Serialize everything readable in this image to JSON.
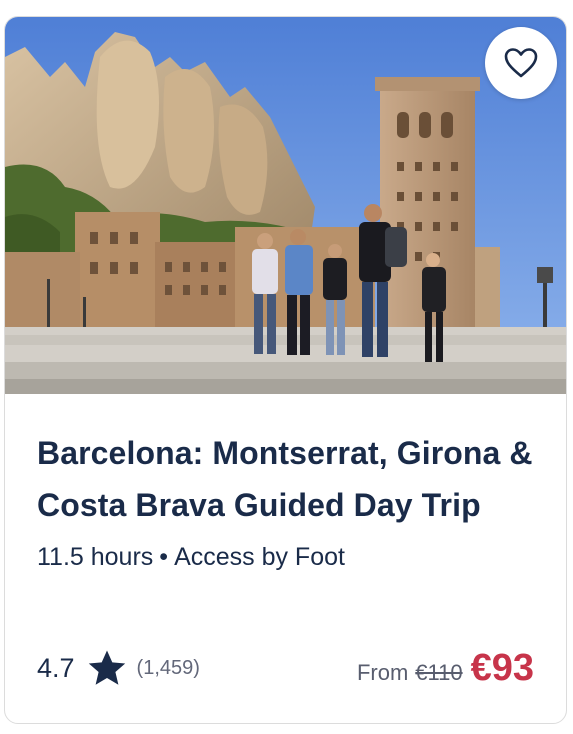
{
  "card": {
    "title": "Barcelona: Montserrat, Girona & Costa Brava Guided Day Trip",
    "duration": "11.5 hours",
    "separator": "•",
    "access": "Access by Foot",
    "rating": {
      "score": "4.7",
      "count": "(1,459)"
    },
    "price": {
      "from_label": "From",
      "original": "€110",
      "current": "€93"
    },
    "icons": {
      "favorite": "heart-outline-icon",
      "rating": "star-filled-icon"
    },
    "colors": {
      "title": "#1a2b49",
      "price": "#c7344a",
      "muted": "#585d6e"
    }
  }
}
